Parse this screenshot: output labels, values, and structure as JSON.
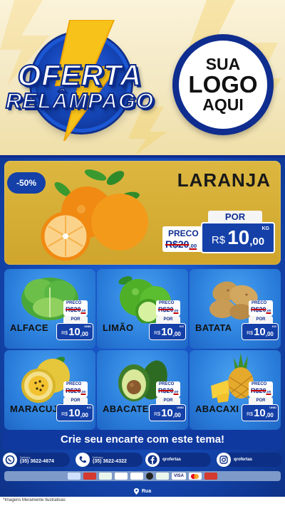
{
  "header": {
    "title_line1": "OFERTA",
    "title_line2": "RELÂMPAGO",
    "logo_line1": "SUA",
    "logo_line2": "LOGO",
    "logo_line3": "AQUI"
  },
  "featured": {
    "discount": "-50%",
    "name": "LARANJA",
    "price_label": "PRECO",
    "old_price": "R$20,00",
    "old_int": "R$20",
    "old_dec": ",00",
    "por_label": "POR",
    "currency": "R$",
    "new_int": "10",
    "new_dec": ",00",
    "unit": "KG"
  },
  "products": [
    {
      "name": "ALFACE",
      "price_label": "PRECO",
      "old_int": "R$20",
      "old_dec": ",00",
      "por_label": "POR",
      "currency": "R$",
      "new_int": "10",
      "new_dec": ",00",
      "unit": "UNID"
    },
    {
      "name": "LIMÃO",
      "price_label": "PRECO",
      "old_int": "R$20",
      "old_dec": ",00",
      "por_label": "POR",
      "currency": "R$",
      "new_int": "10",
      "new_dec": ",00",
      "unit": "KG"
    },
    {
      "name": "BATATA",
      "price_label": "PRECO",
      "old_int": "R$20",
      "old_dec": ",00",
      "por_label": "POR",
      "currency": "R$",
      "new_int": "10",
      "new_dec": ",00",
      "unit": "KG"
    },
    {
      "name": "MARACUJÁ",
      "price_label": "PRECO",
      "old_int": "R$20",
      "old_dec": ",00",
      "por_label": "POR",
      "currency": "R$",
      "new_int": "10",
      "new_dec": ",00",
      "unit": "KG"
    },
    {
      "name": "ABACATE",
      "price_label": "PRECO",
      "old_int": "R$20",
      "old_dec": ",00",
      "por_label": "POR",
      "currency": "R$",
      "new_int": "10",
      "new_dec": ",00",
      "unit": "UNID"
    },
    {
      "name": "ABACAXI",
      "price_label": "PRECO",
      "old_int": "R$20",
      "old_dec": ",00",
      "por_label": "POR",
      "currency": "R$",
      "new_int": "10",
      "new_dec": ",00",
      "unit": "UNID"
    }
  ],
  "cta": "Crie seu encarte com este tema!",
  "contacts": [
    {
      "icon": "whatsapp-icon",
      "small": "Delivery",
      "text": "(35) 3622-4674"
    },
    {
      "icon": "phone-icon",
      "small": "Delivery",
      "text": "(35) 3622-4322"
    },
    {
      "icon": "facebook-icon",
      "small": "",
      "text": "qrofertas"
    },
    {
      "icon": "instagram-icon",
      "small": "",
      "text": "qrofertas"
    }
  ],
  "payments": [
    "VISA"
  ],
  "address": "Rua",
  "footnote": "*Imagens Meramente Ilustrativas",
  "colors": {
    "header_bg": "#f3e8c2",
    "main_blue": "#1448b3",
    "featured_gold": "#d4ad35",
    "card_blue": "#2b7fdc",
    "tag_blue": "#1440a8",
    "strike_red": "#c40000"
  }
}
